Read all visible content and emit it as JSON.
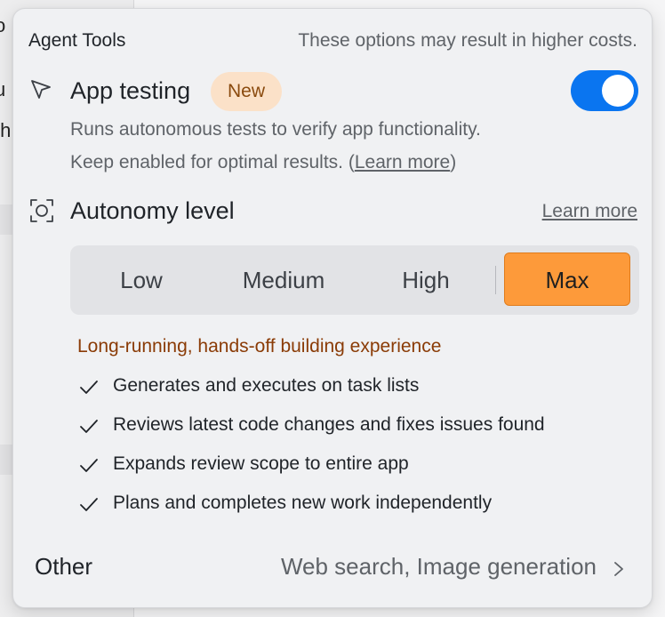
{
  "background": {
    "snippets": [
      "o",
      "u",
      "th"
    ]
  },
  "header": {
    "title": "Agent Tools",
    "note": "These options may result in higher costs."
  },
  "app_testing": {
    "icon": "cursor-arrow-icon",
    "label": "App testing",
    "badge": "New",
    "enabled": true,
    "description_line1": "Runs autonomous tests to verify app functionality.",
    "description_line2_prefix": "Keep enabled for optimal results. (",
    "description_link": "Learn more",
    "description_line2_suffix": ")"
  },
  "autonomy": {
    "icon": "focus-frame-icon",
    "label": "Autonomy level",
    "learn_more": "Learn more",
    "options": [
      "Low",
      "Medium",
      "High",
      "Max"
    ],
    "selected": "Max",
    "headline": "Long-running, hands-off building experience",
    "features": [
      "Generates and executes on task lists",
      "Reviews latest code changes and fixes issues found",
      "Expands review scope to entire app",
      "Plans and completes new work independently"
    ]
  },
  "other": {
    "label": "Other",
    "value": "Web search, Image generation"
  },
  "colors": {
    "toggle_on": "#0a75f0",
    "selected_segment": "#fd9a3a",
    "badge_bg": "#fbe1c8",
    "headline_text": "#8a3b06"
  }
}
